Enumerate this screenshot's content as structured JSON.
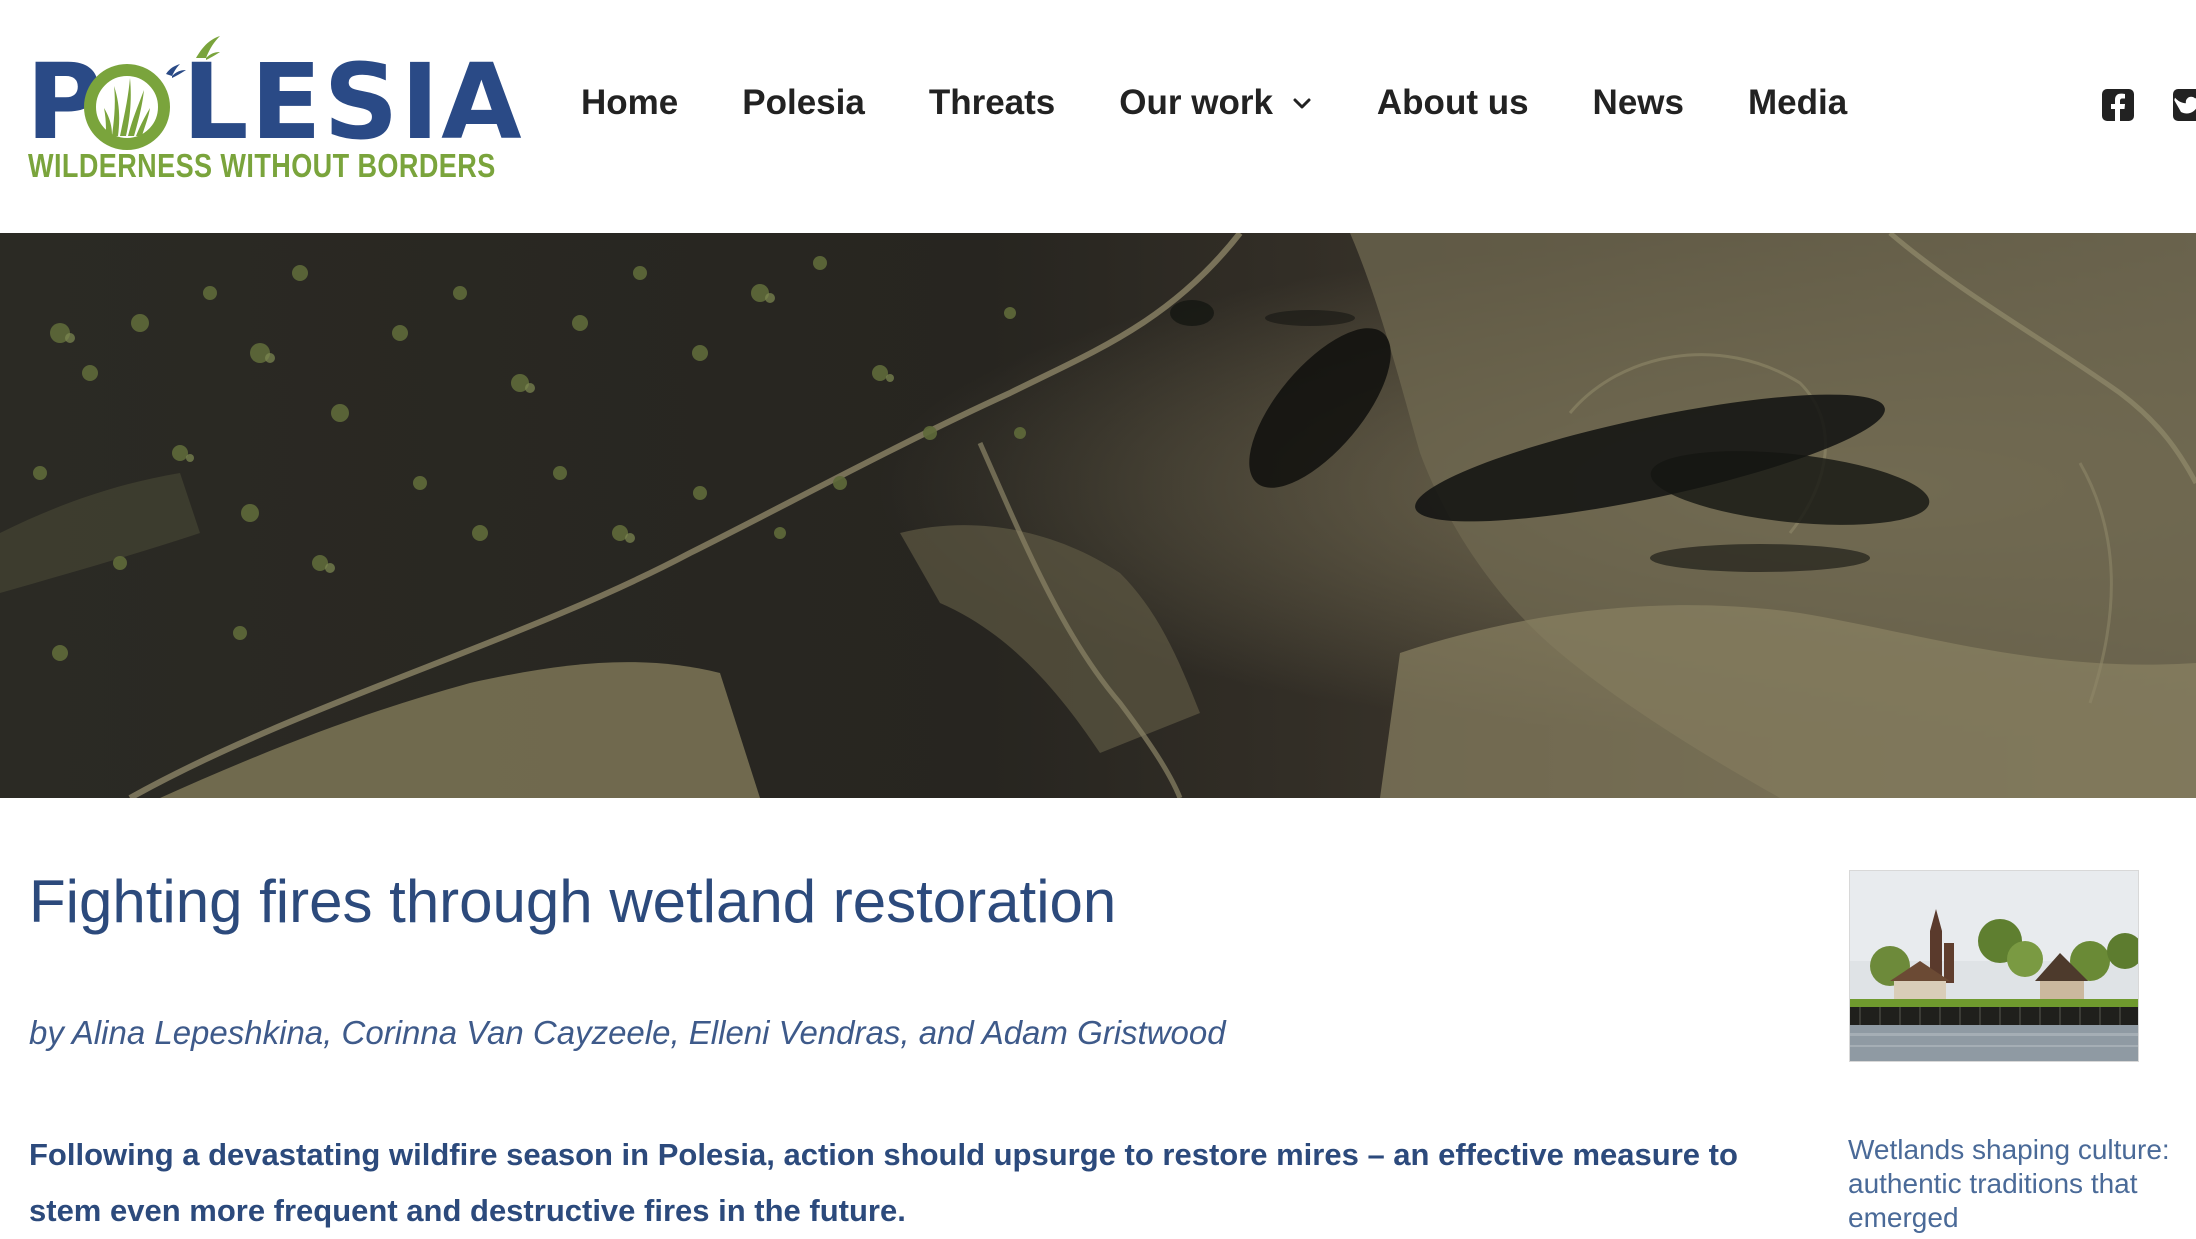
{
  "brand": {
    "logo_text_before_o": "P",
    "logo_text_after_o": "LESIA",
    "tagline": "WILDERNESS WITHOUT BORDERS",
    "colors": {
      "navy": "#2a4a86",
      "green": "#7aa43c"
    }
  },
  "nav": {
    "items": [
      {
        "label": "Home"
      },
      {
        "label": "Polesia"
      },
      {
        "label": "Threats"
      },
      {
        "label": "Our work",
        "has_dropdown": true
      },
      {
        "label": "About us"
      },
      {
        "label": "News"
      },
      {
        "label": "Media"
      }
    ]
  },
  "social": {
    "icons": [
      "facebook-icon",
      "twitter-icon"
    ]
  },
  "article": {
    "title": "Fighting fires through wetland restoration",
    "byline": "by Alina Lepeshkina, Corinna Van Cayzeele, Elleni Vendras, and Adam Gristwood",
    "lead": "Following a devastating wildfire season in Polesia, action should upsurge to restore mires – an effective measure to stem even more frequent and destructive fires in the future."
  },
  "sidebar": {
    "related_caption": "Wetlands shaping culture: authentic traditions that emerged"
  },
  "colors": {
    "heading": "#2c4a7c",
    "nav_text": "#222222"
  }
}
